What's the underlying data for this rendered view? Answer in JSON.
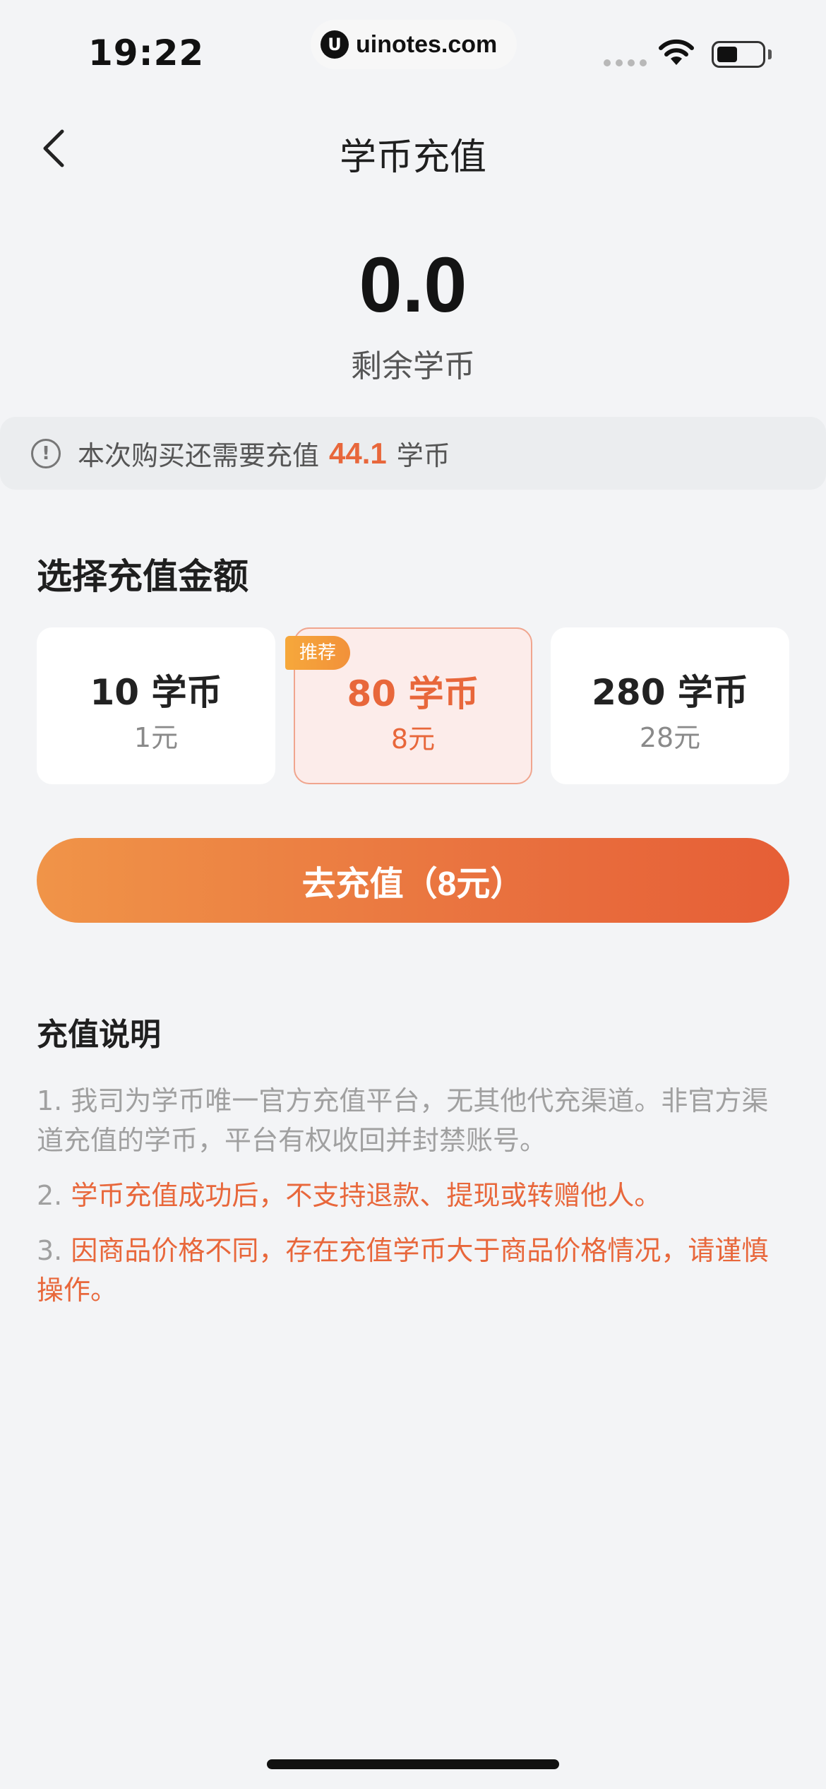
{
  "status_bar": {
    "time": "19:22",
    "url": "uinotes.com",
    "logo_letter": "U"
  },
  "nav": {
    "title": "学币充值",
    "back_icon": "chevron-left-icon"
  },
  "balance": {
    "value": "0.0",
    "label": "剩余学币"
  },
  "notice": {
    "icon": "info-icon",
    "text": "本次购买还需要充值",
    "amount": "44.1",
    "unit": "学币"
  },
  "recharge": {
    "section_title": "选择充值金额",
    "options": [
      {
        "coins": "10 学币",
        "price": "1元",
        "selected": false
      },
      {
        "coins": "80 学币",
        "price": "8元",
        "selected": true,
        "badge": "推荐"
      },
      {
        "coins": "280 学币",
        "price": "28元",
        "selected": false
      }
    ],
    "cta_label": "去充值（8元）"
  },
  "instructions": {
    "title": "充值说明",
    "items": [
      {
        "num": "1.",
        "text": "我司为学币唯一官方充值平台，无其他代充渠道。非官方渠道充值的学币，平台有权收回并封禁账号。",
        "highlight": false
      },
      {
        "num": "2.",
        "text": "学币充值成功后，不支持退款、提现或转赠他人。",
        "highlight": true
      },
      {
        "num": "3.",
        "text": "因商品价格不同，存在充值学币大于商品价格情况，请谨慎操作。",
        "highlight": true
      }
    ]
  },
  "colors": {
    "accent": "#e8673b",
    "background": "#f3f4f6",
    "badge": "#f6a83b",
    "selected_bg": "#fcecea"
  }
}
